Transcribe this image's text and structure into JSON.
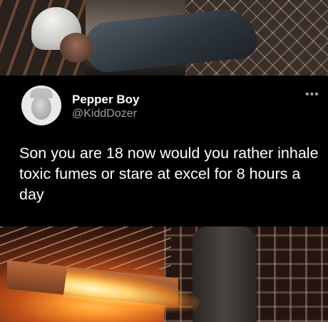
{
  "tweet": {
    "display_name": "Pepper Boy",
    "handle": "@KiddDozer",
    "text": "Son you are 18 now would you rather inhale toxic fumes or stare at excel for 8 hours a day",
    "more_icon": "more-horizontal-icon"
  },
  "colors": {
    "background": "#000000",
    "text_primary": "#ffffff",
    "text_secondary": "#9aa0a6"
  }
}
